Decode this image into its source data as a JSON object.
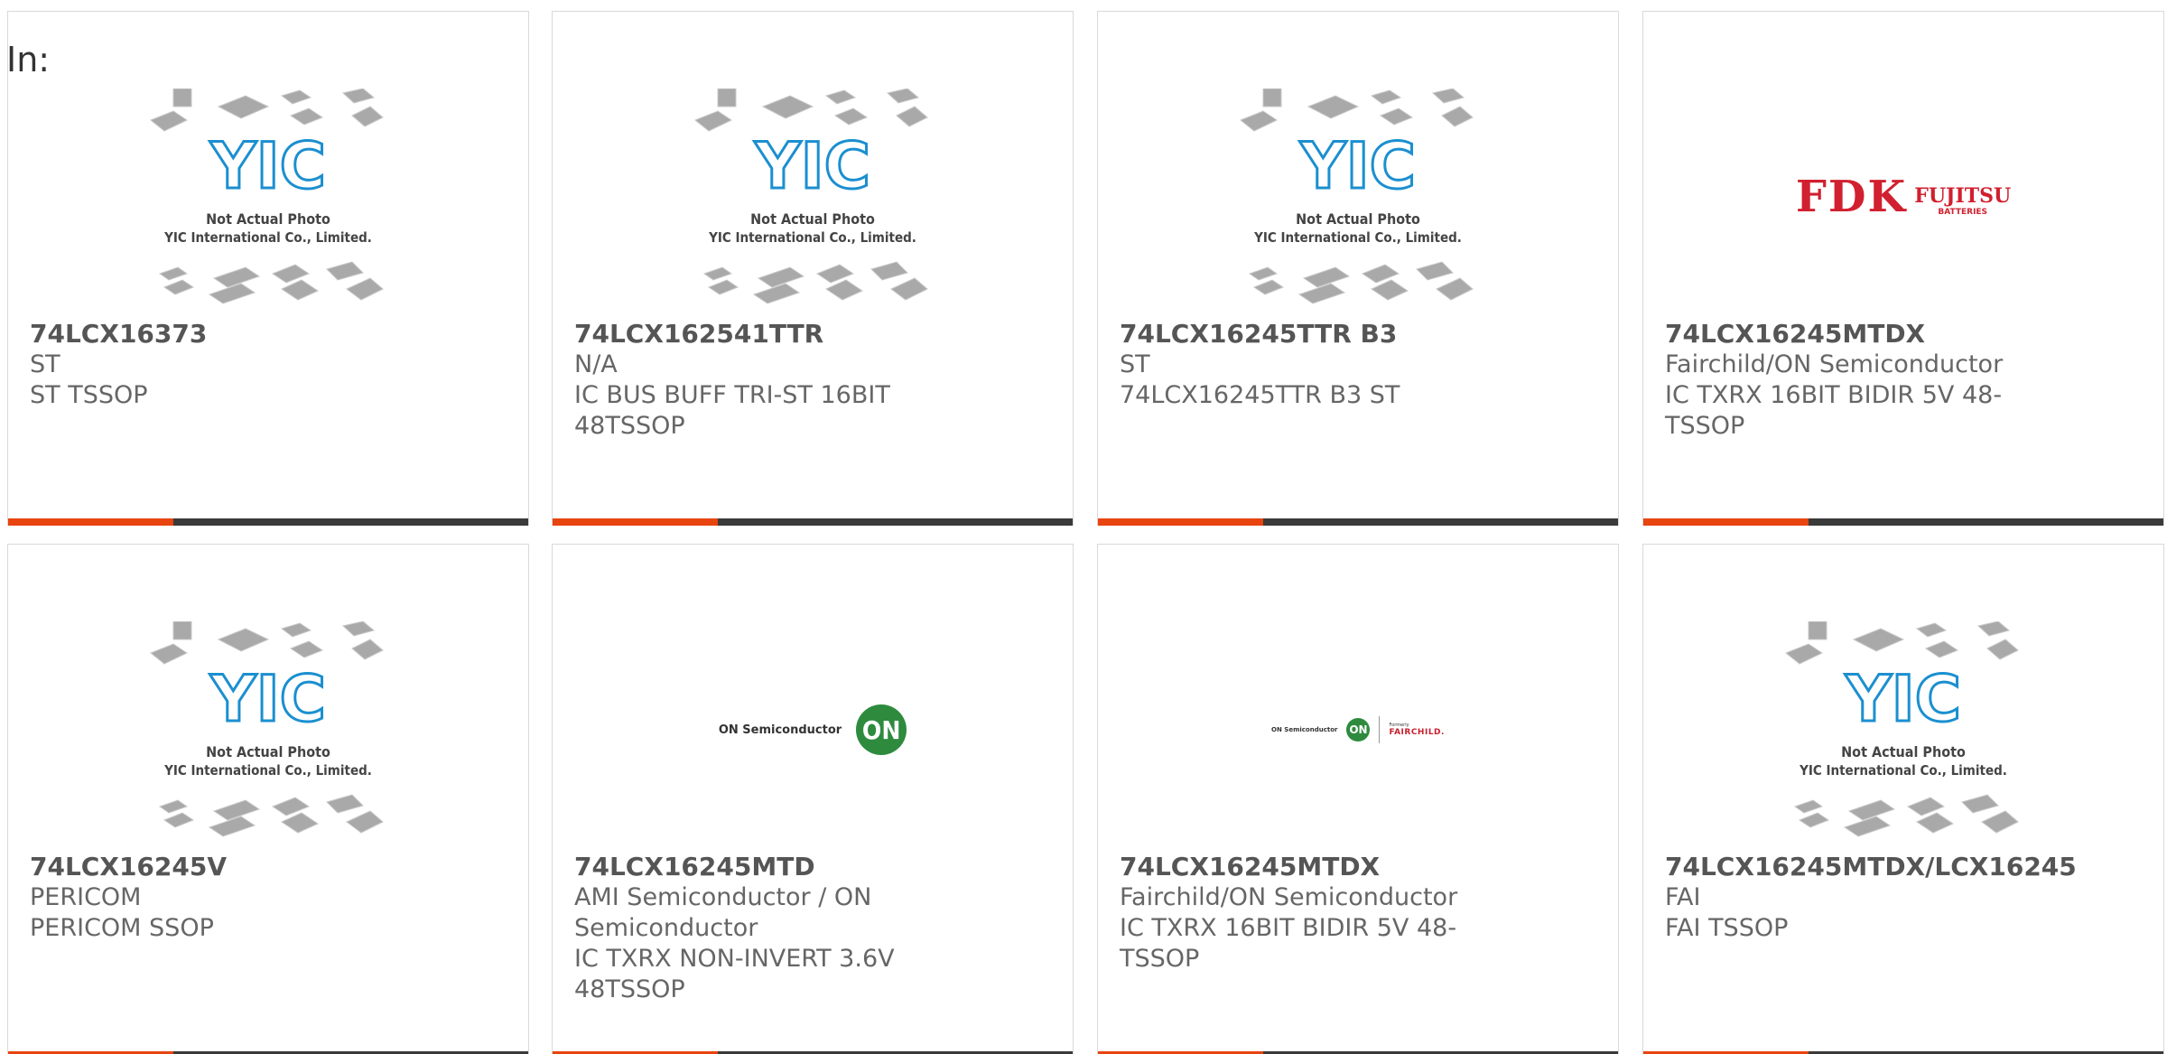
{
  "header": {
    "in_label": "In:"
  },
  "placeholder_image": {
    "logo_text": "YIC",
    "line1": "Not Actual Photo",
    "line2": "YIC International Co., Limited."
  },
  "logos": {
    "fdk": {
      "main": "FDK",
      "brand": "FUJITSU",
      "sub": "BATTERIES"
    },
    "on_semi": {
      "text": "ON Semiconductor",
      "badge": "ON"
    },
    "on_fairchild": {
      "text": "ON Semiconductor",
      "badge": "ON",
      "formerly": "Formerly",
      "fairchild": "FAIRCHILD."
    }
  },
  "colors": {
    "accent": "#e8440f",
    "bar": "#3a3a3a",
    "yic_blue": "#1b8fd0"
  },
  "products": [
    {
      "part": "74LCX16373",
      "manufacturer": "ST",
      "description": "ST TSSOP",
      "image": "yic-placeholder"
    },
    {
      "part": "74LCX162541TTR",
      "manufacturer": "N/A",
      "description": "IC BUS BUFF TRI-ST 16BIT 48TSSOP",
      "image": "yic-placeholder"
    },
    {
      "part": "74LCX16245TTR B3",
      "manufacturer": "ST",
      "description": "74LCX16245TTR B3 ST",
      "image": "yic-placeholder"
    },
    {
      "part": "74LCX16245MTDX",
      "manufacturer": "Fairchild/ON Semiconductor",
      "description": "IC TXRX 16BIT BIDIR 5V 48-TSSOP",
      "image": "fdk-logo"
    },
    {
      "part": "74LCX16245V",
      "manufacturer": "PERICOM",
      "description": "PERICOM SSOP",
      "image": "yic-placeholder"
    },
    {
      "part": "74LCX16245MTD",
      "manufacturer": "AMI Semiconductor / ON Semiconductor",
      "description": "IC TXRX NON-INVERT 3.6V 48TSSOP",
      "image": "on-semi-logo"
    },
    {
      "part": "74LCX16245MTDX",
      "manufacturer": "Fairchild/ON Semiconductor",
      "description": "IC TXRX 16BIT BIDIR 5V 48-TSSOP",
      "image": "on-fairchild-logo"
    },
    {
      "part": "74LCX16245MTDX/LCX16245",
      "manufacturer": "FAI",
      "description": "FAI TSSOP",
      "image": "yic-placeholder"
    }
  ]
}
